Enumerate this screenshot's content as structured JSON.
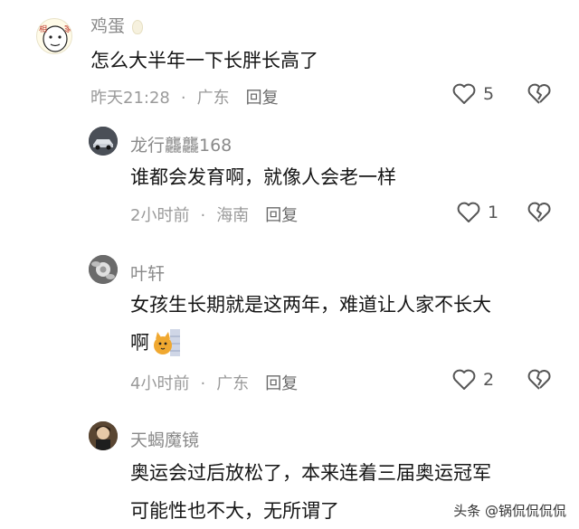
{
  "comments": [
    {
      "name": "鸡蛋",
      "name_badge": "egg-emoji",
      "text_lines": [
        "怎么大半年一下长胖长高了"
      ],
      "time": "昨天21:28",
      "location": "广东",
      "reply_label": "回复",
      "likes": "5",
      "avatar": "cartoon-face-avatar"
    },
    {
      "name": "龙行龘龘168",
      "text_lines": [
        "谁都会发育啊，就像人会老一样"
      ],
      "time": "2小时前",
      "location": "海南",
      "reply_label": "回复",
      "likes": "1",
      "avatar": "car-avatar"
    },
    {
      "name": "叶轩",
      "text_lines": [
        "女孩生长期就是这两年，难道让人家不长大",
        "啊"
      ],
      "time": "4小时前",
      "location": "广东",
      "reply_label": "回复",
      "likes": "2",
      "avatar": "flower-avatar",
      "emoji": "peeking-cat-sticker"
    },
    {
      "name": "天蝎魔镜",
      "text_lines": [
        "奥运会过后放松了，本来连着三届奥运冠军",
        "可能性也不大，无所谓了"
      ],
      "avatar": "portrait-avatar"
    }
  ],
  "watermark": "头条 @锅侃侃侃侃",
  "colors": {
    "name": "#8a8a8a",
    "meta": "#9a9a9a",
    "text": "#161616"
  }
}
